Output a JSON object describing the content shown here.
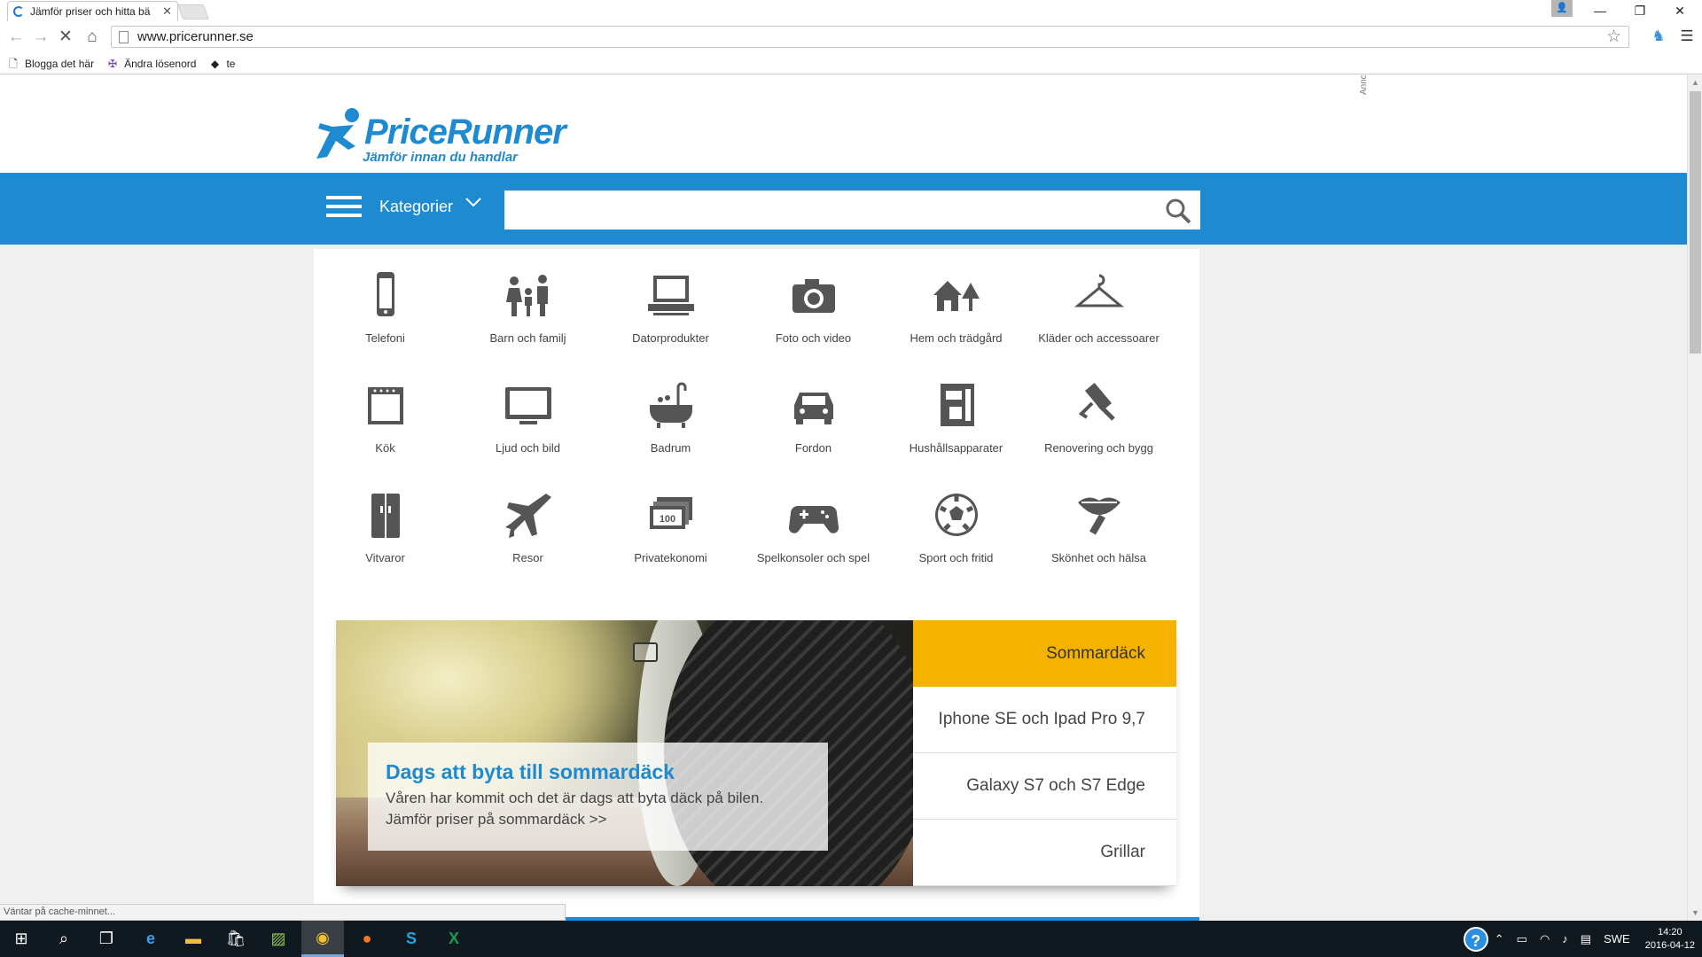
{
  "browser": {
    "tab_title": "Jämför priser och hitta bä",
    "url": "www.pricerunner.se",
    "bookmarks": [
      {
        "label": "Blogga det här",
        "icon": "page-icon"
      },
      {
        "label": "Ändra lösenord",
        "icon": "key-icon"
      },
      {
        "label": "te",
        "icon": "diamond-icon"
      }
    ],
    "status_text": "Väntar på cache-minnet..."
  },
  "site": {
    "brand": "PriceRunner",
    "tagline": "Jämför innan du handlar",
    "ad_label": "Annons",
    "brand_color": "#1e8ad0",
    "accent_color": "#f5b300"
  },
  "nav": {
    "categories_label": "Kategorier",
    "search_placeholder": ""
  },
  "categories": [
    {
      "label": "Telefoni",
      "icon": "phone-icon"
    },
    {
      "label": "Barn och familj",
      "icon": "family-icon"
    },
    {
      "label": "Datorprodukter",
      "icon": "laptop-icon"
    },
    {
      "label": "Foto och video",
      "icon": "camera-icon"
    },
    {
      "label": "Hem och trädgård",
      "icon": "house-tree-icon"
    },
    {
      "label": "Kläder och accessoarer",
      "icon": "hanger-icon"
    },
    {
      "label": "Kök",
      "icon": "oven-icon"
    },
    {
      "label": "Ljud och bild",
      "icon": "tv-icon"
    },
    {
      "label": "Badrum",
      "icon": "bathtub-icon"
    },
    {
      "label": "Fordon",
      "icon": "car-icon"
    },
    {
      "label": "Hushållsapparater",
      "icon": "coffee-machine-icon"
    },
    {
      "label": "Renovering och bygg",
      "icon": "paint-roller-icon"
    },
    {
      "label": "Vitvaror",
      "icon": "fridge-icon"
    },
    {
      "label": "Resor",
      "icon": "airplane-icon"
    },
    {
      "label": "Privatekonomi",
      "icon": "banknotes-icon"
    },
    {
      "label": "Spelkonsoler och spel",
      "icon": "gamepad-icon"
    },
    {
      "label": "Sport och fritid",
      "icon": "football-icon"
    },
    {
      "label": "Skönhet och hälsa",
      "icon": "lips-icon"
    }
  ],
  "carousel": {
    "headline": "Dags att byta till sommardäck",
    "body_line1": "Våren har kommit och det är dags att byta däck på bilen.",
    "body_line2": "Jämför priser på sommardäck >>",
    "tabs": [
      {
        "label": "Sommardäck",
        "active": true
      },
      {
        "label": "Iphone SE och Ipad Pro 9,7",
        "active": false
      },
      {
        "label": "Galaxy S7 och S7 Edge",
        "active": false
      },
      {
        "label": "Grillar",
        "active": false
      }
    ]
  },
  "taskbar": {
    "language": "SWE",
    "time": "14:20",
    "date": "2016-04-12",
    "apps": [
      "start-icon",
      "search-icon",
      "task-view-icon",
      "edge-icon",
      "file-explorer-icon",
      "store-icon",
      "photo-app-icon",
      "chrome-icon",
      "firefox-icon",
      "skype-icon",
      "excel-icon"
    ]
  }
}
